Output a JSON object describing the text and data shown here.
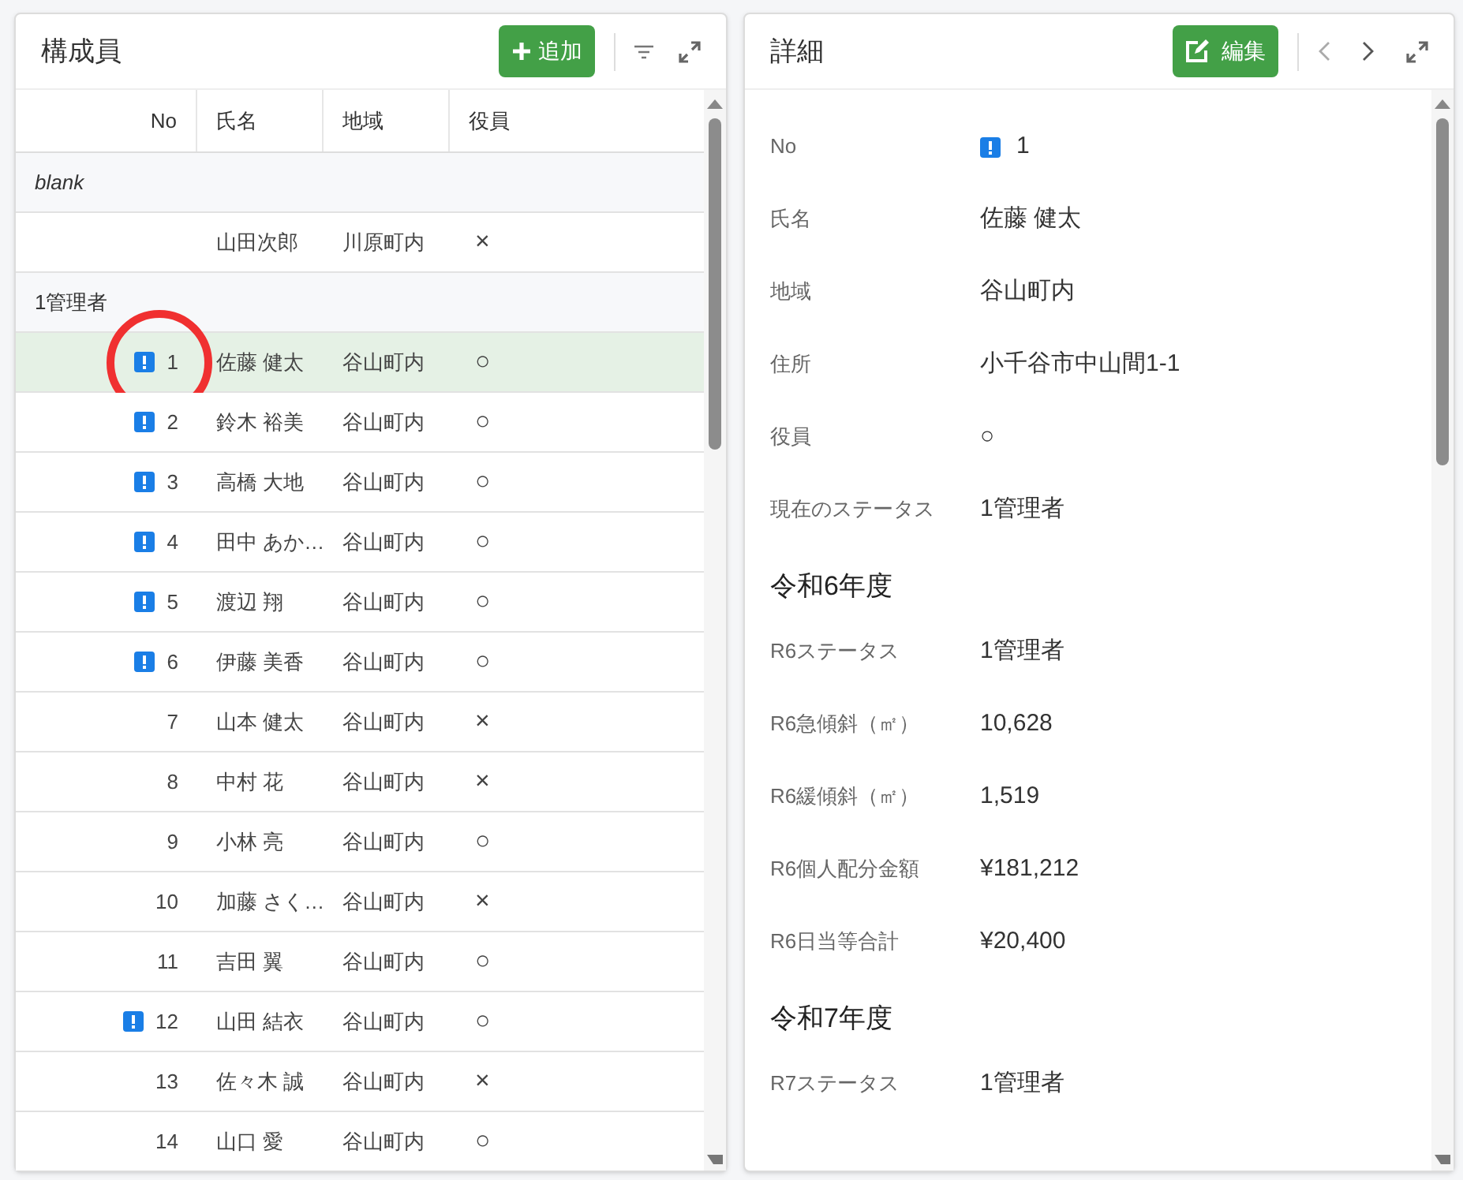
{
  "members": {
    "title": "構成員",
    "add_label": "追加",
    "columns": [
      "No",
      "氏名",
      "地域",
      "役員"
    ],
    "groups": [
      {
        "label": "blank",
        "kind": "empty",
        "rows": [
          {
            "no": "",
            "alert": false,
            "name": "山田次郎",
            "area": "川原町内",
            "officer": "×",
            "selected": false,
            "circled": false
          }
        ]
      },
      {
        "label": "1管理者",
        "kind": "status",
        "rows": [
          {
            "no": "1",
            "alert": true,
            "name": "佐藤 健太",
            "area": "谷山町内",
            "officer": "○",
            "selected": true,
            "circled": true
          },
          {
            "no": "2",
            "alert": true,
            "name": "鈴木 裕美",
            "area": "谷山町内",
            "officer": "○",
            "selected": false,
            "circled": false
          },
          {
            "no": "3",
            "alert": true,
            "name": "高橋 大地",
            "area": "谷山町内",
            "officer": "○",
            "selected": false,
            "circled": false
          },
          {
            "no": "4",
            "alert": true,
            "name": "田中 あか…",
            "area": "谷山町内",
            "officer": "○",
            "selected": false,
            "circled": false
          },
          {
            "no": "5",
            "alert": true,
            "name": "渡辺 翔",
            "area": "谷山町内",
            "officer": "○",
            "selected": false,
            "circled": false
          },
          {
            "no": "6",
            "alert": true,
            "name": "伊藤 美香",
            "area": "谷山町内",
            "officer": "○",
            "selected": false,
            "circled": false
          },
          {
            "no": "7",
            "alert": false,
            "name": "山本 健太",
            "area": "谷山町内",
            "officer": "×",
            "selected": false,
            "circled": false
          },
          {
            "no": "8",
            "alert": false,
            "name": "中村 花",
            "area": "谷山町内",
            "officer": "×",
            "selected": false,
            "circled": false
          },
          {
            "no": "9",
            "alert": false,
            "name": "小林 亮",
            "area": "谷山町内",
            "officer": "○",
            "selected": false,
            "circled": false
          },
          {
            "no": "10",
            "alert": false,
            "name": "加藤 さく…",
            "area": "谷山町内",
            "officer": "×",
            "selected": false,
            "circled": false
          },
          {
            "no": "11",
            "alert": false,
            "name": "吉田 翼",
            "area": "谷山町内",
            "officer": "○",
            "selected": false,
            "circled": false
          },
          {
            "no": "12",
            "alert": true,
            "name": "山田 結衣",
            "area": "谷山町内",
            "officer": "○",
            "selected": false,
            "circled": false
          },
          {
            "no": "13",
            "alert": false,
            "name": "佐々木 誠",
            "area": "谷山町内",
            "officer": "×",
            "selected": false,
            "circled": false
          },
          {
            "no": "14",
            "alert": false,
            "name": "山口 愛",
            "area": "谷山町内",
            "officer": "○",
            "selected": false,
            "circled": false
          }
        ]
      }
    ]
  },
  "detail": {
    "title": "詳細",
    "edit_label": "編集",
    "fields": [
      {
        "kind": "field",
        "label": "No",
        "value": "1",
        "alert": true
      },
      {
        "kind": "field",
        "label": "氏名",
        "value": "佐藤 健太",
        "alert": false
      },
      {
        "kind": "field",
        "label": "地域",
        "value": "谷山町内",
        "alert": false
      },
      {
        "kind": "field",
        "label": "住所",
        "value": "小千谷市中山間1-1",
        "alert": false
      },
      {
        "kind": "field",
        "label": "役員",
        "value": "○",
        "alert": false
      },
      {
        "kind": "field",
        "label": "現在のステータス",
        "value": "1管理者",
        "alert": false
      },
      {
        "kind": "heading",
        "label": "令和6年度"
      },
      {
        "kind": "field",
        "label": "R6ステータス",
        "value": "1管理者",
        "alert": false
      },
      {
        "kind": "field",
        "label": "R6急傾斜（㎡）",
        "value": "10,628",
        "alert": false
      },
      {
        "kind": "field",
        "label": "R6緩傾斜（㎡）",
        "value": "1,519",
        "alert": false
      },
      {
        "kind": "field",
        "label": "R6個人配分金額",
        "value": "¥181,212",
        "alert": false
      },
      {
        "kind": "field",
        "label": "R6日当等合計",
        "value": "¥20,400",
        "alert": false
      },
      {
        "kind": "heading",
        "label": "令和7年度"
      },
      {
        "kind": "field",
        "label": "R7ステータス",
        "value": "1管理者",
        "alert": false
      }
    ]
  }
}
